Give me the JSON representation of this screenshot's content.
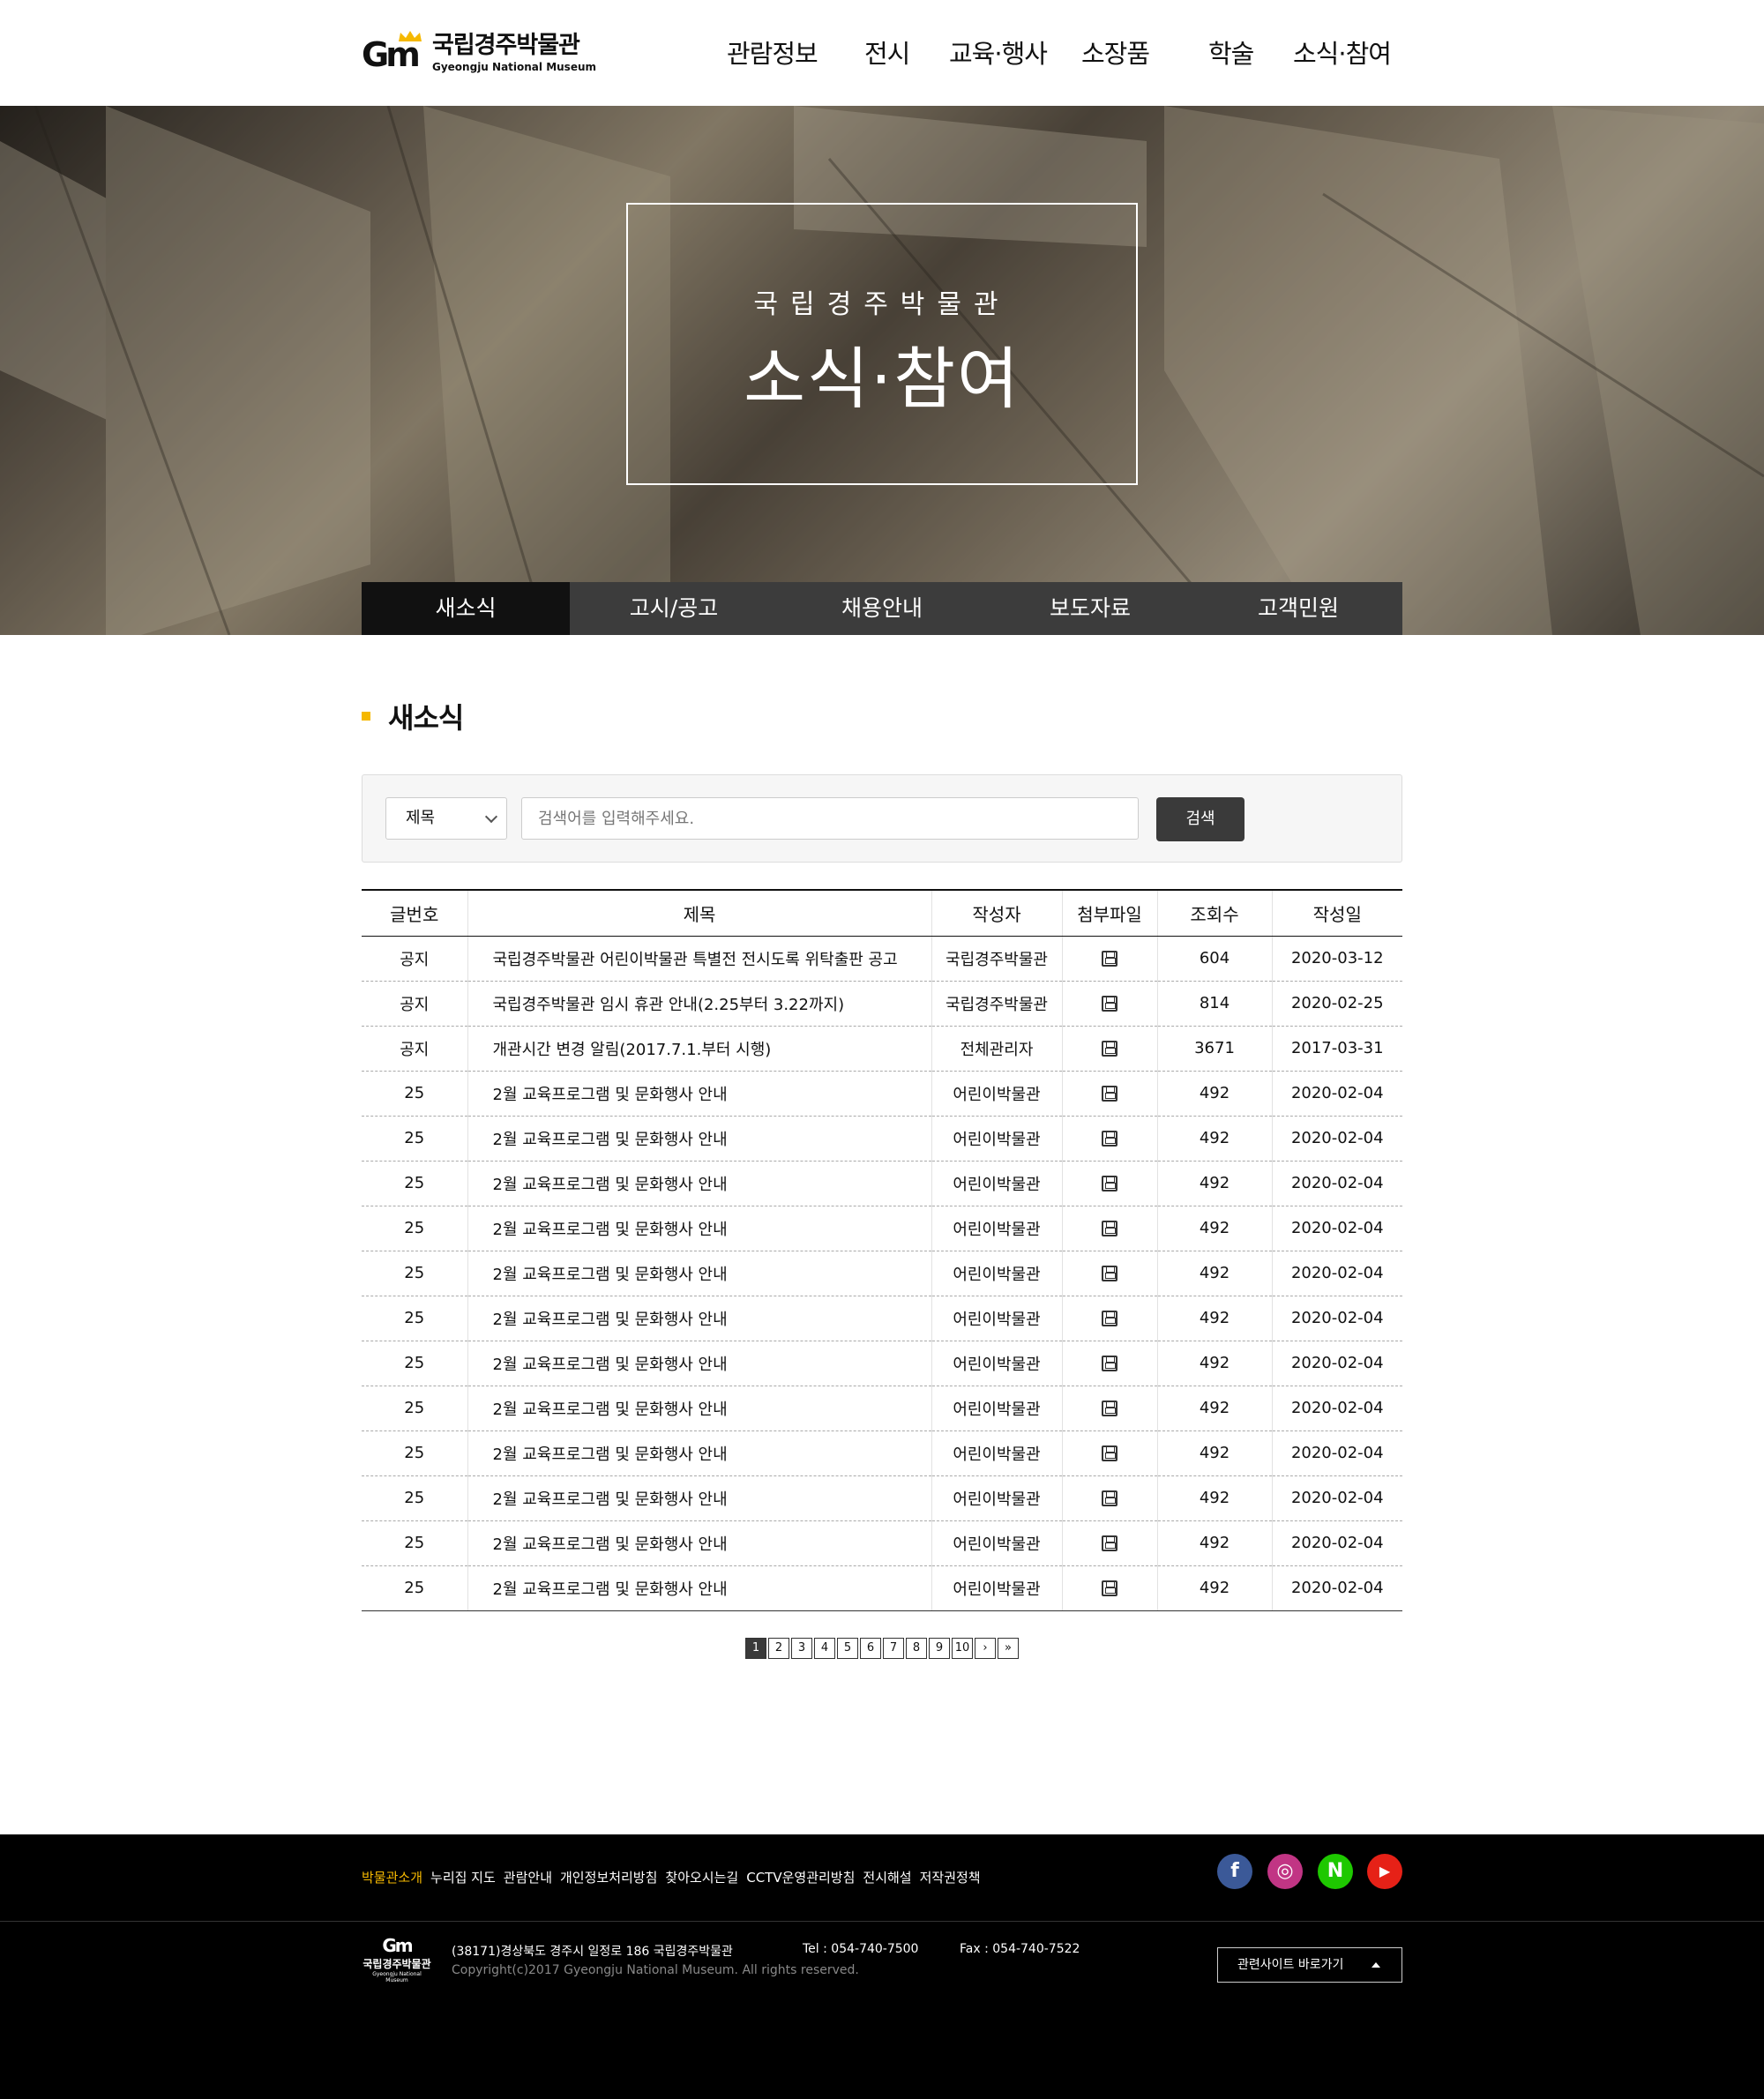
{
  "header": {
    "logo_ko": "국립경주박물관",
    "logo_en": "Gyeongju National Museum",
    "logo_mark": "Gm",
    "nav": [
      "관람정보",
      "전시",
      "교육·행사",
      "소장품",
      "학술",
      "소식·참여"
    ]
  },
  "hero": {
    "subtitle": "국립경주박물관",
    "title": "소식·참여"
  },
  "lnb": {
    "items": [
      "새소식",
      "고시/공고",
      "채용안내",
      "보도자료",
      "고객민원"
    ],
    "active_index": 0
  },
  "section": {
    "title": "새소식"
  },
  "search": {
    "select_value": "제목",
    "placeholder": "검색어를 입력해주세요.",
    "button": "검색"
  },
  "board": {
    "columns": [
      "글번호",
      "제목",
      "작성자",
      "첨부파일",
      "조회수",
      "작성일"
    ],
    "rows": [
      {
        "no": "공지",
        "title": "국립경주박물관 어린이박물관 특별전 전시도록 위탁출판 공고",
        "writer": "국립경주박물관",
        "file": "save-icon",
        "views": "604",
        "date": "2020-03-12"
      },
      {
        "no": "공지",
        "title": "국립경주박물관 임시 휴관 안내(2.25부터 3.22까지)",
        "writer": "국립경주박물관",
        "file": "save-icon",
        "views": "814",
        "date": "2020-02-25"
      },
      {
        "no": "공지",
        "title": "개관시간 변경 알림(2017.7.1.부터 시행)",
        "writer": "전체관리자",
        "file": "save-icon",
        "views": "3671",
        "date": "2017-03-31"
      },
      {
        "no": "25",
        "title": "2월 교육프로그램 및 문화행사 안내",
        "writer": "어린이박물관",
        "file": "save-icon",
        "views": "492",
        "date": "2020-02-04"
      },
      {
        "no": "25",
        "title": "2월 교육프로그램 및 문화행사 안내",
        "writer": "어린이박물관",
        "file": "save-icon",
        "views": "492",
        "date": "2020-02-04"
      },
      {
        "no": "25",
        "title": "2월 교육프로그램 및 문화행사 안내",
        "writer": "어린이박물관",
        "file": "save-icon",
        "views": "492",
        "date": "2020-02-04"
      },
      {
        "no": "25",
        "title": "2월 교육프로그램 및 문화행사 안내",
        "writer": "어린이박물관",
        "file": "save-icon",
        "views": "492",
        "date": "2020-02-04"
      },
      {
        "no": "25",
        "title": "2월 교육프로그램 및 문화행사 안내",
        "writer": "어린이박물관",
        "file": "save-icon",
        "views": "492",
        "date": "2020-02-04"
      },
      {
        "no": "25",
        "title": "2월 교육프로그램 및 문화행사 안내",
        "writer": "어린이박물관",
        "file": "save-icon",
        "views": "492",
        "date": "2020-02-04"
      },
      {
        "no": "25",
        "title": "2월 교육프로그램 및 문화행사 안내",
        "writer": "어린이박물관",
        "file": "save-icon",
        "views": "492",
        "date": "2020-02-04"
      },
      {
        "no": "25",
        "title": "2월 교육프로그램 및 문화행사 안내",
        "writer": "어린이박물관",
        "file": "save-icon",
        "views": "492",
        "date": "2020-02-04"
      },
      {
        "no": "25",
        "title": "2월 교육프로그램 및 문화행사 안내",
        "writer": "어린이박물관",
        "file": "save-icon",
        "views": "492",
        "date": "2020-02-04"
      },
      {
        "no": "25",
        "title": "2월 교육프로그램 및 문화행사 안내",
        "writer": "어린이박물관",
        "file": "save-icon",
        "views": "492",
        "date": "2020-02-04"
      },
      {
        "no": "25",
        "title": "2월 교육프로그램 및 문화행사 안내",
        "writer": "어린이박물관",
        "file": "save-icon",
        "views": "492",
        "date": "2020-02-04"
      },
      {
        "no": "25",
        "title": "2월 교육프로그램 및 문화행사 안내",
        "writer": "어린이박물관",
        "file": "save-icon",
        "views": "492",
        "date": "2020-02-04"
      }
    ]
  },
  "pagination": {
    "pages": [
      "1",
      "2",
      "3",
      "4",
      "5",
      "6",
      "7",
      "8",
      "9",
      "10"
    ],
    "current": "1",
    "next": "›",
    "last": "»"
  },
  "footer": {
    "links": [
      "박물관소개",
      "누리집 지도",
      "관람안내",
      "개인정보처리방침",
      "찾아오시는길",
      "CCTV운영관리방침",
      "전시해설",
      "저작권정책"
    ],
    "highlight_color": "#f5b800",
    "sns": [
      {
        "name": "facebook-icon",
        "glyph": "f",
        "color": "#3b5998"
      },
      {
        "name": "instagram-icon",
        "glyph": "◎",
        "color": "#c13584"
      },
      {
        "name": "naver-icon",
        "glyph": "N",
        "color": "#1ec800"
      },
      {
        "name": "youtube-icon",
        "glyph": "▶",
        "color": "#e62117"
      }
    ],
    "logo_mark": "Gm",
    "logo_ko": "국립경주박물관",
    "logo_en": "Gyeongju National Museum",
    "address": "(38171)경상북도 경주시 일정로 186 국립경주박물관",
    "tel": "Tel : 054-740-7500",
    "fax": "Fax : 054-740-7522",
    "copyright": "Copyright(c)2017 Gyeongju National Museum. All rights reserved.",
    "related": "관련사이트 바로가기"
  }
}
